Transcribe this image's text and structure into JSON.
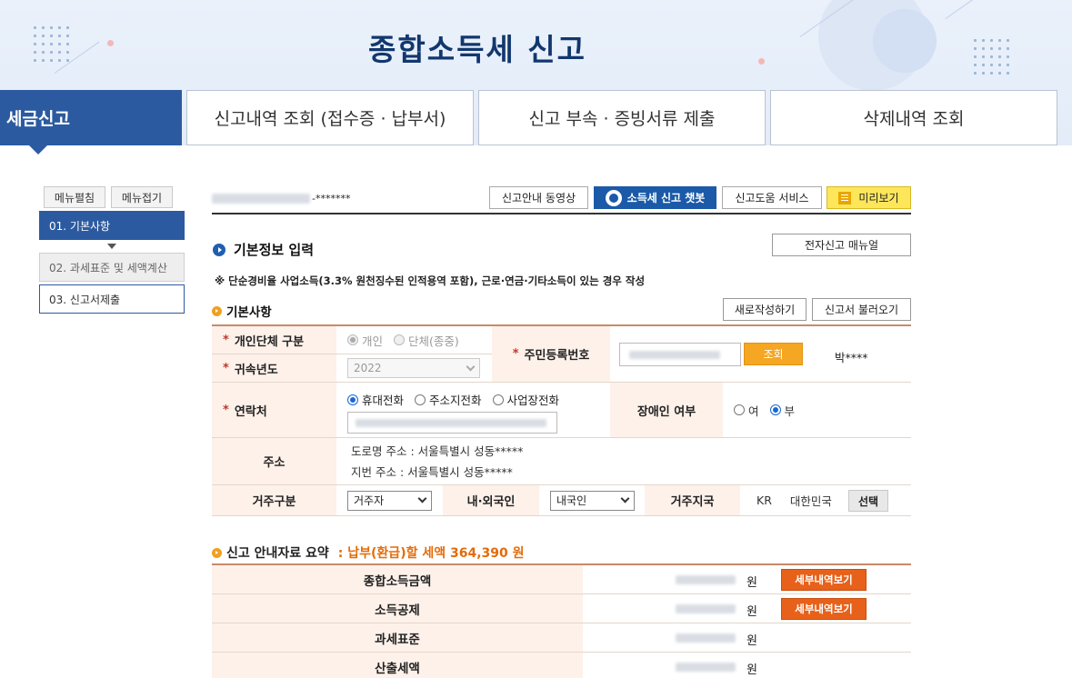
{
  "page_title": "종합소득세 신고",
  "tabs": [
    {
      "label": "세금신고",
      "active": true
    },
    {
      "label": "신고내역 조회 (접수증 · 납부서)"
    },
    {
      "label": "신고 부속 · 증빙서류 제출"
    },
    {
      "label": "삭제내역 조회"
    }
  ],
  "menu": {
    "expand_label": "메뉴펼침",
    "collapse_label": "메뉴접기",
    "steps": [
      "01. 기본사항",
      "02. 과세표준 및 세액계산",
      "03. 신고서제출"
    ]
  },
  "toolbar": {
    "user_masked": "-*******",
    "guide_video": "신고안내 동영상",
    "chatbot": "소득세 신고 챗봇",
    "help_service": "신고도움 서비스",
    "preview": "미리보기"
  },
  "basic_info": {
    "title": "기본정보 입력",
    "manual_button": "전자신고 매뉴얼",
    "note": "※ 단순경비율 사업소득(3.3% 원천징수된 인적용역 포함), 근로·연금·기타소득이 있는 경우 작성",
    "section_title": "기본사항",
    "new_button": "새로작성하기",
    "load_button": "신고서 불러오기"
  },
  "form": {
    "entity_type": {
      "label": "개인단체 구분",
      "options": [
        "개인",
        "단체(종중)"
      ],
      "selected": "개인"
    },
    "tax_year": {
      "label": "귀속년도",
      "value": "2022"
    },
    "resident_no": {
      "label": "주민등록번호",
      "lookup_button": "조회",
      "name_masked": "박****"
    },
    "contact": {
      "label": "연락처",
      "options": [
        "휴대전화",
        "주소지전화",
        "사업장전화"
      ],
      "selected": "휴대전화"
    },
    "disabled": {
      "label": "장애인 여부",
      "options": [
        "여",
        "부"
      ],
      "selected": "부"
    },
    "address": {
      "label": "주소",
      "road": "도로명 주소 :  서울특별시 성동*****",
      "lot": "지번 주소 :  서울특별시 성동*****"
    },
    "residence_type": {
      "label": "거주구분",
      "value": "거주자"
    },
    "nationality": {
      "label": "내·외국인",
      "value": "내국인"
    },
    "residence_country": {
      "label": "거주지국",
      "code": "KR",
      "name": "대한민국",
      "select_button": "선택"
    }
  },
  "summary": {
    "title": "신고 안내자료 요약",
    "highlight": ": 납부(환급)할 세액 364,390 원",
    "unit": "원",
    "detail_button": "세부내역보기",
    "rows": [
      {
        "label": "종합소득금액",
        "has_detail": true
      },
      {
        "label": "소득공제",
        "has_detail": true
      },
      {
        "label": "과세표준",
        "has_detail": false
      },
      {
        "label": "산출세액",
        "has_detail": false
      }
    ]
  },
  "colors": {
    "primary": "#2c5aa0",
    "title": "#12376e",
    "label_bg": "#fdf1ea",
    "accent_orange": "#e8611a",
    "highlight": "#e36c09",
    "preview_yellow": "#fde65a"
  }
}
